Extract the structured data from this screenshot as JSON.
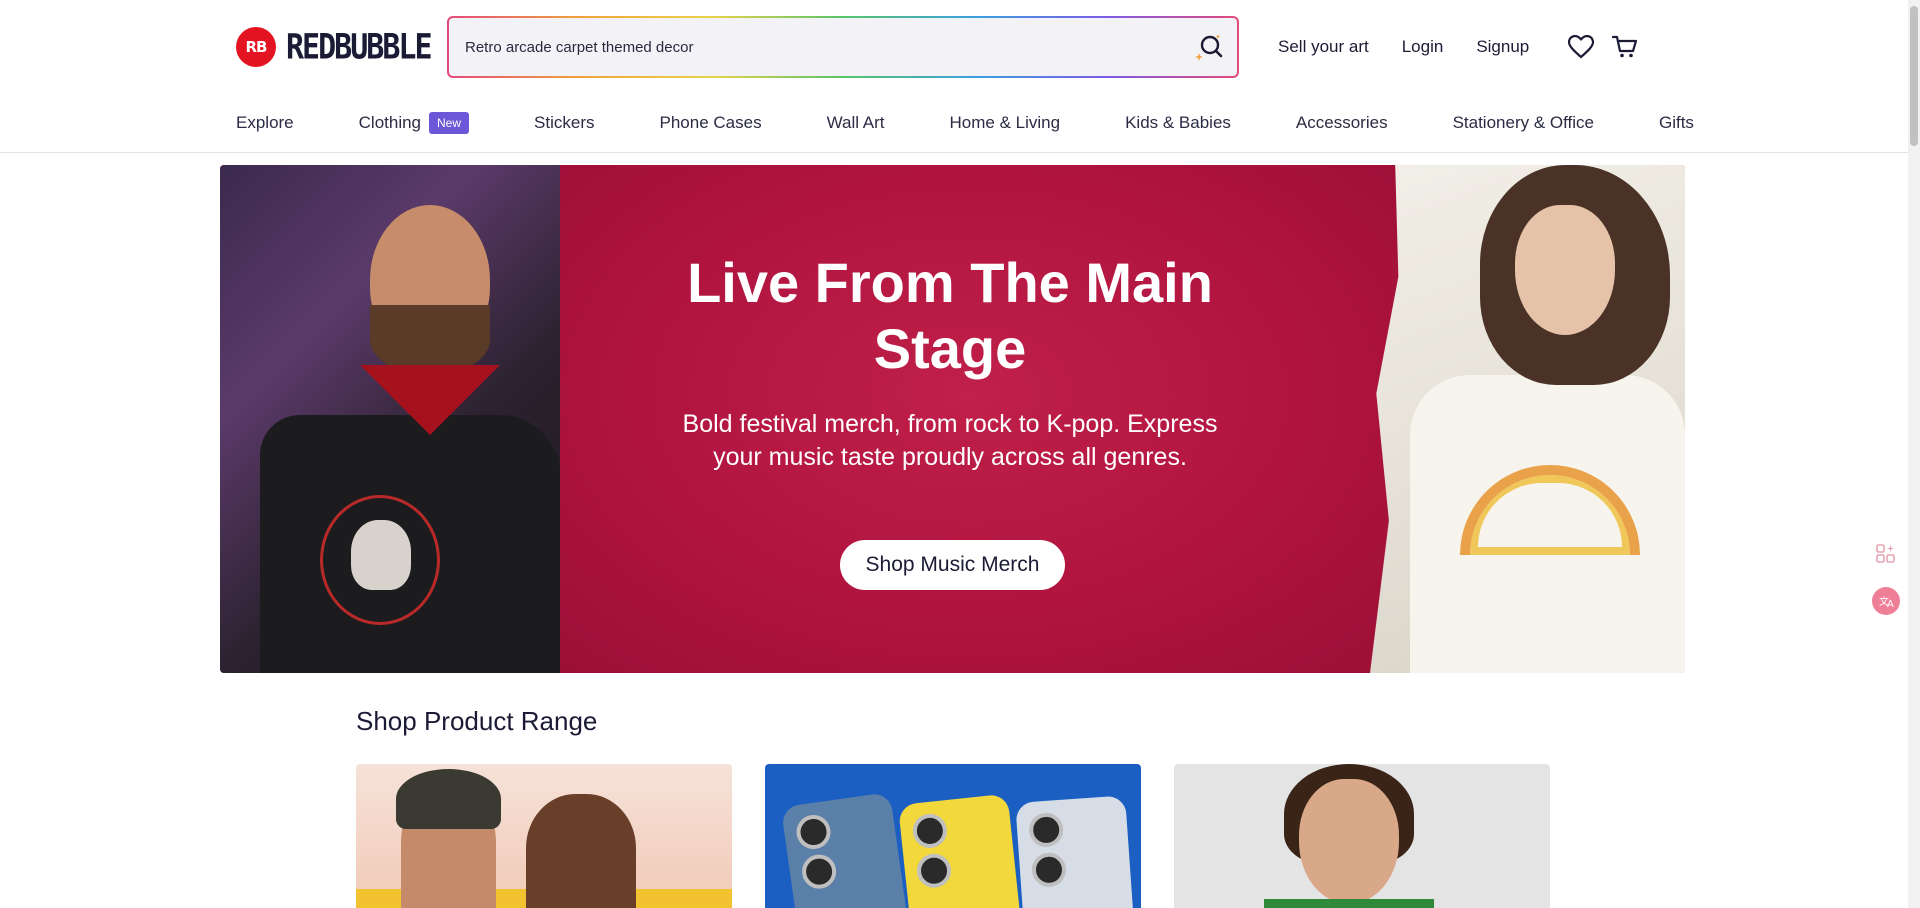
{
  "header": {
    "brand": "REDBUBBLE",
    "logo_mark": "RB",
    "search": {
      "value": "Retro arcade carpet themed decor",
      "placeholder": ""
    },
    "links": {
      "sell": "Sell your art",
      "login": "Login",
      "signup": "Signup"
    },
    "icons": {
      "search": "search-icon",
      "wishlist": "heart-icon",
      "cart": "cart-icon"
    }
  },
  "nav": {
    "items": [
      {
        "label": "Explore"
      },
      {
        "label": "Clothing",
        "badge": "New"
      },
      {
        "label": "Stickers"
      },
      {
        "label": "Phone Cases"
      },
      {
        "label": "Wall Art"
      },
      {
        "label": "Home & Living"
      },
      {
        "label": "Kids & Babies"
      },
      {
        "label": "Accessories"
      },
      {
        "label": "Stationery & Office"
      },
      {
        "label": "Gifts"
      }
    ]
  },
  "hero": {
    "title": "Live From The Main Stage",
    "subtitle": "Bold festival merch, from rock to K-pop. Express your music taste proudly across all genres.",
    "cta": "Shop Music Merch"
  },
  "section": {
    "title": "Shop Product Range"
  },
  "colors": {
    "brand": "#e41321",
    "hero_bg": "#b5163f",
    "badge": "#6b57d8",
    "text": "#1b1b36"
  }
}
